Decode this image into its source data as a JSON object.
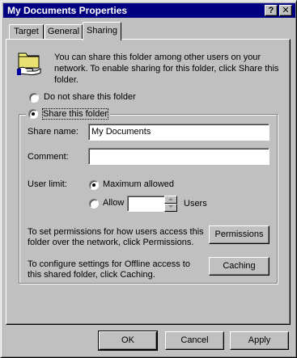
{
  "window": {
    "title": "My Documents Properties",
    "help_glyph": "?",
    "close_glyph": "✕"
  },
  "tabs": [
    {
      "label": "Target",
      "active": false
    },
    {
      "label": "General",
      "active": false
    },
    {
      "label": "Sharing",
      "active": true
    }
  ],
  "sharing": {
    "info_icon": "shared-folder-icon",
    "info_text": "You can share this folder among other users on your network.  To enable sharing for this folder, click Share this folder.",
    "info_line1": "You can share this folder among other users on your",
    "info_line2": "network.  To enable sharing for this folder, click Share this",
    "info_line3": "folder.",
    "do_not_share": {
      "label": "Do not share this folder",
      "selected": false
    },
    "share": {
      "label": "Share this folder",
      "selected": true
    },
    "share_name": {
      "label": "Share name:",
      "value": "My Documents"
    },
    "comment": {
      "label": "Comment:",
      "value": ""
    },
    "user_limit": {
      "label": "User limit:",
      "maximum_allowed": {
        "label": "Maximum allowed",
        "selected": true
      },
      "allow": {
        "label": "Allow",
        "selected": false,
        "value": ""
      },
      "users_suffix": "Users"
    },
    "permissions_text_line1": "To set permissions for how users access this",
    "permissions_text_line2": "folder over the network, click Permissions.",
    "permissions_button": "Permissions",
    "caching_text_line1": "To configure settings for Offline access to",
    "caching_text_line2": "this shared folder, click Caching.",
    "caching_button": "Caching"
  },
  "footer": {
    "ok": "OK",
    "cancel": "Cancel",
    "apply": "Apply"
  }
}
